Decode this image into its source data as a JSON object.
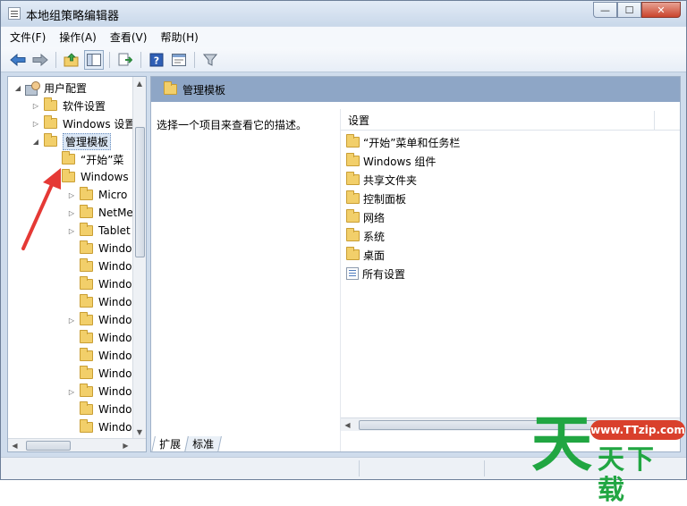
{
  "window": {
    "title": "本地组策略编辑器",
    "controls": {
      "minimize": "—",
      "maximize": "☐",
      "close": "✕"
    }
  },
  "menubar": {
    "items": [
      "文件(F)",
      "操作(A)",
      "查看(V)",
      "帮助(H)"
    ]
  },
  "toolbar": {
    "icons": [
      "back-icon",
      "forward-icon",
      "up-folder-icon",
      "show-hide-tree-icon",
      "export-list-icon",
      "help-icon",
      "properties-icon",
      "filter-icon"
    ]
  },
  "tree": {
    "items": [
      {
        "label": "用户配置",
        "icon": "user-config-icon",
        "expand": "◢",
        "depth": 0
      },
      {
        "label": "软件设置",
        "icon": "folder-icon",
        "expand": "▷",
        "depth": 1
      },
      {
        "label": "Windows 设置",
        "icon": "folder-icon",
        "expand": "▷",
        "depth": 1
      },
      {
        "label": "管理模板",
        "icon": "folder-icon",
        "expand": "◢",
        "depth": 1,
        "selected": true
      },
      {
        "label": "“开始”菜",
        "icon": "folder-icon",
        "expand": "",
        "depth": 2
      },
      {
        "label": "Windows",
        "icon": "folder-icon",
        "expand": "◢",
        "depth": 2
      },
      {
        "label": "Micro",
        "icon": "folder-icon",
        "expand": "▷",
        "depth": 3
      },
      {
        "label": "NetMe",
        "icon": "folder-icon",
        "expand": "▷",
        "depth": 3
      },
      {
        "label": "Tablet",
        "icon": "folder-icon",
        "expand": "▷",
        "depth": 3
      },
      {
        "label": "Windo",
        "icon": "folder-icon",
        "expand": "",
        "depth": 3
      },
      {
        "label": "Windo",
        "icon": "folder-icon",
        "expand": "",
        "depth": 3
      },
      {
        "label": "Windo",
        "icon": "folder-icon",
        "expand": "",
        "depth": 3
      },
      {
        "label": "Windo",
        "icon": "folder-icon",
        "expand": "",
        "depth": 3
      },
      {
        "label": "Windo",
        "icon": "folder-icon",
        "expand": "▷",
        "depth": 3
      },
      {
        "label": "Windo",
        "icon": "folder-icon",
        "expand": "",
        "depth": 3
      },
      {
        "label": "Windo",
        "icon": "folder-icon",
        "expand": "",
        "depth": 3
      },
      {
        "label": "Windo",
        "icon": "folder-icon",
        "expand": "",
        "depth": 3
      },
      {
        "label": "Windo",
        "icon": "folder-icon",
        "expand": "▷",
        "depth": 3
      },
      {
        "label": "Windo",
        "icon": "folder-icon",
        "expand": "",
        "depth": 3
      },
      {
        "label": "Windo",
        "icon": "folder-icon",
        "expand": "",
        "depth": 3
      }
    ]
  },
  "details": {
    "header_title": "管理模板",
    "description": "选择一个项目来查看它的描述。",
    "column_header": "设置",
    "items": [
      {
        "label": "“开始”菜单和任务栏",
        "icon": "folder-icon"
      },
      {
        "label": "Windows 组件",
        "icon": "folder-icon"
      },
      {
        "label": "共享文件夹",
        "icon": "folder-icon"
      },
      {
        "label": "控制面板",
        "icon": "folder-icon"
      },
      {
        "label": "网络",
        "icon": "folder-icon"
      },
      {
        "label": "系统",
        "icon": "folder-icon"
      },
      {
        "label": "桌面",
        "icon": "folder-icon"
      },
      {
        "label": "所有设置",
        "icon": "all-settings-icon"
      }
    ]
  },
  "tabs": [
    "扩展",
    "标准"
  ],
  "watermark": {
    "url": "www.TTzip.com",
    "big_char": "天",
    "small_text": "天下载"
  },
  "colors": {
    "header_bar": "#8ea6c6",
    "arrow": "#e53935",
    "watermark_green": "#21a642",
    "watermark_red": "#d9402c"
  }
}
